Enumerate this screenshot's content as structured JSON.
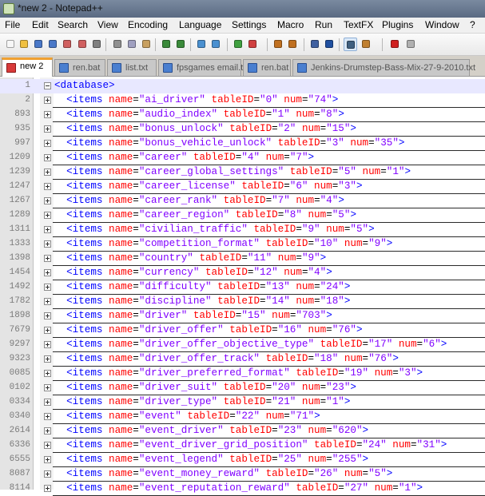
{
  "window": {
    "title": "*new  2 - Notepad++"
  },
  "menu": [
    "File",
    "Edit",
    "Search",
    "View",
    "Encoding",
    "Language",
    "Settings",
    "Macro",
    "Run",
    "TextFX",
    "Plugins",
    "Window",
    "?"
  ],
  "toolbar": {
    "buttons": [
      "new-file-icon",
      "open-file-icon",
      "save-icon",
      "save-all-icon",
      "close-icon",
      "close-all-icon",
      "print-icon",
      "cut-icon",
      "copy-icon",
      "paste-icon",
      "undo-icon",
      "redo-icon",
      "find-icon",
      "replace-icon",
      "zoom-in-icon",
      "zoom-out-icon",
      "sync-v-icon",
      "sync-h-icon",
      "wrap-icon",
      "all-chars-icon",
      "indent-guide-icon",
      "user-lang-icon",
      "record-macro-icon",
      "stop-macro-icon"
    ]
  },
  "tabs": [
    {
      "label": "new  2",
      "active": true
    },
    {
      "label": "ren.bat",
      "active": false
    },
    {
      "label": "list.txt",
      "active": false
    },
    {
      "label": "fpsgames email.txt",
      "active": false
    },
    {
      "label": "ren.bat",
      "active": false
    },
    {
      "label": "Jenkins-Drumstep-Bass-Mix-27-9-2010.txt",
      "active": false
    }
  ],
  "lines": [
    {
      "num": "1",
      "fold": "minus",
      "root": true,
      "tag": "database"
    },
    {
      "num": "2",
      "fold": "plus",
      "name": "ai_driver",
      "tableID": "0",
      "n": "74"
    },
    {
      "num": "893",
      "fold": "plus",
      "name": "audio_index",
      "tableID": "1",
      "n": "8"
    },
    {
      "num": "935",
      "fold": "plus",
      "name": "bonus_unlock",
      "tableID": "2",
      "n": "15"
    },
    {
      "num": "997",
      "fold": "plus",
      "name": "bonus_vehicle_unlock",
      "tableID": "3",
      "n": "35"
    },
    {
      "num": "1209",
      "fold": "plus",
      "name": "career",
      "tableID": "4",
      "n": "7"
    },
    {
      "num": "1239",
      "fold": "plus",
      "name": "career_global_settings",
      "tableID": "5",
      "n": "1"
    },
    {
      "num": "1247",
      "fold": "plus",
      "name": "career_license",
      "tableID": "6",
      "n": "3"
    },
    {
      "num": "1267",
      "fold": "plus",
      "name": "career_rank",
      "tableID": "7",
      "n": "4"
    },
    {
      "num": "1289",
      "fold": "plus",
      "name": "career_region",
      "tableID": "8",
      "n": "5"
    },
    {
      "num": "1311",
      "fold": "plus",
      "name": "civilian_traffic",
      "tableID": "9",
      "n": "5"
    },
    {
      "num": "1333",
      "fold": "plus",
      "name": "competition_format",
      "tableID": "10",
      "n": "9"
    },
    {
      "num": "1398",
      "fold": "plus",
      "name": "country",
      "tableID": "11",
      "n": "9"
    },
    {
      "num": "1454",
      "fold": "plus",
      "name": "currency",
      "tableID": "12",
      "n": "4"
    },
    {
      "num": "1492",
      "fold": "plus",
      "name": "difficulty",
      "tableID": "13",
      "n": "24"
    },
    {
      "num": "1782",
      "fold": "plus",
      "name": "discipline",
      "tableID": "14",
      "n": "18"
    },
    {
      "num": "1898",
      "fold": "plus",
      "name": "driver",
      "tableID": "15",
      "n": "703"
    },
    {
      "num": "7679",
      "fold": "plus",
      "name": "driver_offer",
      "tableID": "16",
      "n": "76"
    },
    {
      "num": "9297",
      "fold": "plus",
      "name": "driver_offer_objective_type",
      "tableID": "17",
      "n": "6"
    },
    {
      "num": "9323",
      "fold": "plus",
      "name": "driver_offer_track",
      "tableID": "18",
      "n": "76"
    },
    {
      "num": "0085",
      "fold": "plus",
      "name": "driver_preferred_format",
      "tableID": "19",
      "n": "3"
    },
    {
      "num": "0102",
      "fold": "plus",
      "name": "driver_suit",
      "tableID": "20",
      "n": "23"
    },
    {
      "num": "0334",
      "fold": "plus",
      "name": "driver_type",
      "tableID": "21",
      "n": "1"
    },
    {
      "num": "0340",
      "fold": "plus",
      "name": "event",
      "tableID": "22",
      "n": "71"
    },
    {
      "num": "2614",
      "fold": "plus",
      "name": "event_driver",
      "tableID": "23",
      "n": "620"
    },
    {
      "num": "6336",
      "fold": "plus",
      "name": "event_driver_grid_position",
      "tableID": "24",
      "n": "31"
    },
    {
      "num": "6555",
      "fold": "plus",
      "name": "event_legend",
      "tableID": "25",
      "n": "255"
    },
    {
      "num": "8087",
      "fold": "plus",
      "name": "event_money_reward",
      "tableID": "26",
      "n": "5"
    },
    {
      "num": "8114",
      "fold": "plus",
      "name": "event_reputation_reward",
      "tableID": "27",
      "n": "1"
    }
  ],
  "colors": {
    "tag": "#0000ff",
    "attr": "#ff0000",
    "value": "#8000ff",
    "activeTab": "#f0a030"
  }
}
